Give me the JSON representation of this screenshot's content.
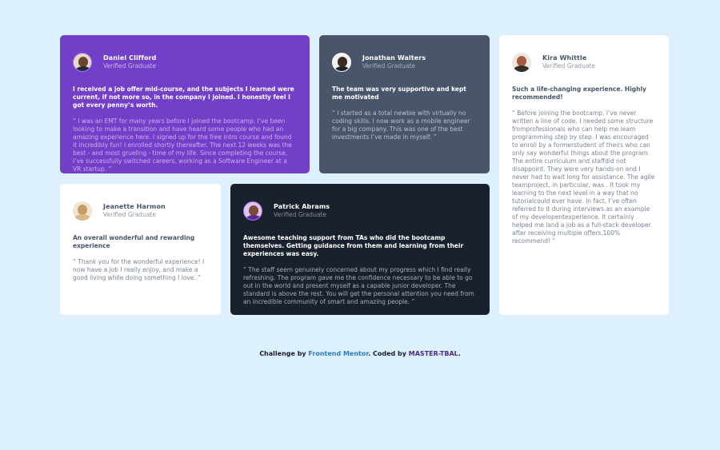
{
  "testimonials": [
    {
      "name": "Daniel Clifford",
      "role": "Verified Graduate",
      "avatar_icon": "avatar-daniel",
      "headline": "I received a job offer mid-course, and the subjects I learned were current, if not more so, in the company I joined. I honestly feel I got every penny’s worth.",
      "quote": "“ I was an EMT for many years before I joined the bootcamp. I’ve been looking to make a transition and have heard some people who had an amazing experience here. I signed up for the free intro course and found it incredibly fun! I enrolled shortly thereafter. The next 12 weeks was the best - and most grueling - time of my life. Since completing the course, I’ve successfully switched careers, working as a Software Engineer at a VR startup. ”",
      "background": "#733fc8"
    },
    {
      "name": "Jonathan Walters",
      "role": "Verified Graduate",
      "avatar_icon": "avatar-jonathan",
      "headline": "The team was very supportive and kept me motivated",
      "quote": "“ I started as a total newbie with virtually no coding skills. I now work as a mobile engineer for a big company. This was one of the best investments I’ve made in myself. ”",
      "background": "#48556a"
    },
    {
      "name": "Kira Whittle",
      "role": "Verified Graduate",
      "avatar_icon": "avatar-kira",
      "headline": "Such a life-changing experience. Highly recommended!",
      "quote": "“ Before joining the bootcamp, I’ve never written a line of code. I needed some structure fromprofessionals who can help me learn programming step by step. I was encouraged to enroll by a formerstudent of theirs who can only say wonderful things about the program. The entire curriculum and staffdid not disappoint. They were very hands-on and I never had to wait long for assistance. The agile teamproject, in particular, was . It took my learning to the next level in a way that no tutorialcould ever have. In fact, I’ve often referred to it during interviews as an example of my developentexperience. It certainly helped me land a job as a full-stack developer after receiving multiple offers.100% recommend! ”",
      "background": "#ffffff"
    },
    {
      "name": "Jeanette Harmon",
      "role": "Verified Graduate",
      "avatar_icon": "avatar-jeanette",
      "headline": "An overall wonderful and rewarding experience",
      "quote": "“ Thank you for the wonderful experience! I now have a job I really enjoy, and make a good living while doing something I love. ”",
      "background": "#ffffff"
    },
    {
      "name": "Patrick Abrams",
      "role": "Verified Graduate",
      "avatar_icon": "avatar-patrick",
      "headline": "Awesome teaching support from TAs who did the bootcamp themselves. Getting guidance from them and learning from their experiences was easy.",
      "quote": "“ The staff seem genuinely concerned about my progress which I find really refreshing. The program gave me the confidence necessary to be able to go out in the world and present myself as a capable junior developer. The standard is above the rest. You will get the personal attention you need from an incredible community of smart and amazing people. ”",
      "background": "#19212e"
    }
  ],
  "footer": {
    "prefix": "Challenge by ",
    "link1": "Frontend Mentor",
    "middle": ". Coded by ",
    "link2": "MASTER-TBAL",
    "suffix": ".",
    "link1_color": "#2b7bc4",
    "link2_color": "#4b2a88"
  },
  "page_background": "#dcf1fd"
}
